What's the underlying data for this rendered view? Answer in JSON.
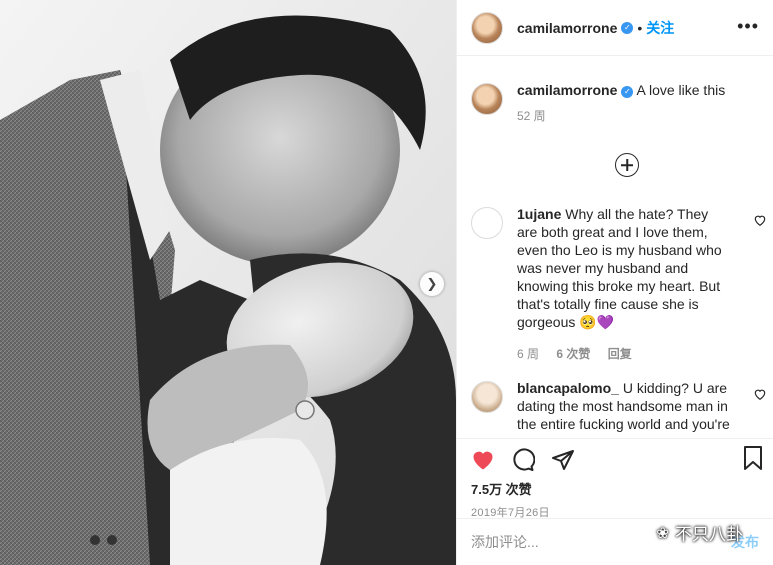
{
  "header": {
    "username": "camilamorrone",
    "separator": "•",
    "follow_label": "关注"
  },
  "caption": {
    "username": "camilamorrone",
    "text": "A love like this",
    "time": "52 周"
  },
  "comments": [
    {
      "username": "1ujane",
      "text": "Why all the hate? They are both great and I love them, even tho Leo is my husband who was never my husband and knowing this broke my heart. But that's totally fine cause she is gorgeous 🥺💜",
      "time": "6 周",
      "likes": "6 次赞",
      "reply": "回复"
    },
    {
      "username": "blancapalomo_",
      "text": "U kidding? U are dating the most handsome man in the entire fucking world and you're"
    }
  ],
  "post": {
    "likes": "7.5万 次赞",
    "date": "2019年7月26日"
  },
  "add_comment": {
    "placeholder": "添加评论...",
    "post_label": "发布"
  },
  "watermark": {
    "text": "不只八卦"
  },
  "colors": {
    "like_red": "#ed4956",
    "link_blue": "#0095f6",
    "verified_blue": "#3897f0",
    "secondary_gray": "#8e8e8e"
  },
  "icons": {
    "like": "heart-filled-icon",
    "comment": "comment-bubble-icon",
    "share": "paper-plane-icon",
    "save": "bookmark-icon",
    "more": "ellipsis-icon",
    "load_more": "plus-circle-icon",
    "next": "chevron-right-icon"
  }
}
